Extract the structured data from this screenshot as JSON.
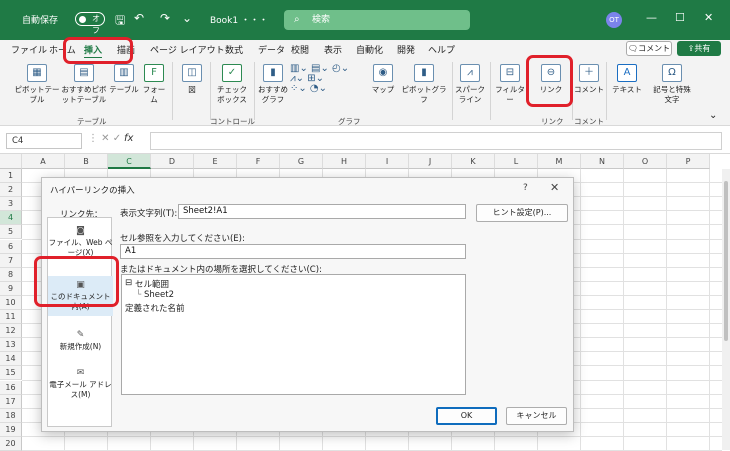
{
  "titlebar": {
    "autosave_label": "自動保存",
    "autosave_state": "オフ",
    "book_name": "Book1 ・・・",
    "search_placeholder": "検索",
    "user_initials": "OT",
    "bg_color": "#1f7a45"
  },
  "menu": {
    "tabs": [
      "ファイル",
      "ホーム",
      "挿入",
      "描画",
      "ページ レイアウト",
      "数式",
      "データ",
      "校閲",
      "表示",
      "自動化",
      "開発",
      "ヘルプ"
    ],
    "active_tab": "挿入",
    "comment_btn": "コメント",
    "share_btn": "共有"
  },
  "ribbon": {
    "buttons": {
      "pivot": "ピボットテーブル",
      "rec_pivot": "おすすめピボットテーブル",
      "table": "テーブル",
      "form": "フォーム",
      "illustration": "図",
      "checkbox": "チェックボックス",
      "rec_chart": "おすすめグラフ",
      "map": "マップ",
      "pivot_chart": "ピボットグラフ",
      "sparkline": "スパークライン",
      "filter": "フィルター",
      "link": "リンク",
      "comment": "コメント",
      "text": "テキスト",
      "symbol": "記号と特殊文字"
    },
    "groups": {
      "table": "テーブル",
      "control": "コントロール",
      "chart": "グラフ",
      "link": "リンク",
      "comment": "コメント"
    }
  },
  "formula": {
    "namebox": "C4",
    "fx": "fx"
  },
  "grid": {
    "columns": [
      "A",
      "B",
      "C",
      "D",
      "E",
      "F",
      "G",
      "H",
      "I",
      "J",
      "K",
      "L",
      "M",
      "N",
      "O",
      "P"
    ],
    "rows": [
      "1",
      "2",
      "3",
      "4",
      "5",
      "6",
      "7",
      "8",
      "9",
      "10",
      "11",
      "12",
      "13",
      "14",
      "15",
      "16",
      "17",
      "18",
      "19",
      "20"
    ],
    "selected_col": "C",
    "selected_row": "4"
  },
  "dialog": {
    "title": "ハイパーリンクの挿入",
    "help": "?",
    "close": "✕",
    "link_to_label": "リンク先：",
    "link_options": [
      "ファイル、Web ページ(X)",
      "このドキュメント内(A)",
      "新規作成(N)",
      "電子メール アドレス(M)"
    ],
    "selected_link_option": "このドキュメント内(A)",
    "display_text_label": "表示文字列(T):",
    "display_text_value": "Sheet2!A1",
    "tooltip_btn": "ヒント設定(P)...",
    "cell_ref_label": "セル参照を入力してください(E):",
    "cell_ref_value": "A1",
    "place_label": "またはドキュメント内の場所を選択してください(C):",
    "tree": {
      "cell_range": "セル範囲",
      "sheet": "Sheet2",
      "defined_names": "定義された名前"
    },
    "ok": "OK",
    "cancel": "キャンセル"
  },
  "annotations": {
    "highlight_color": "#e0202a"
  }
}
